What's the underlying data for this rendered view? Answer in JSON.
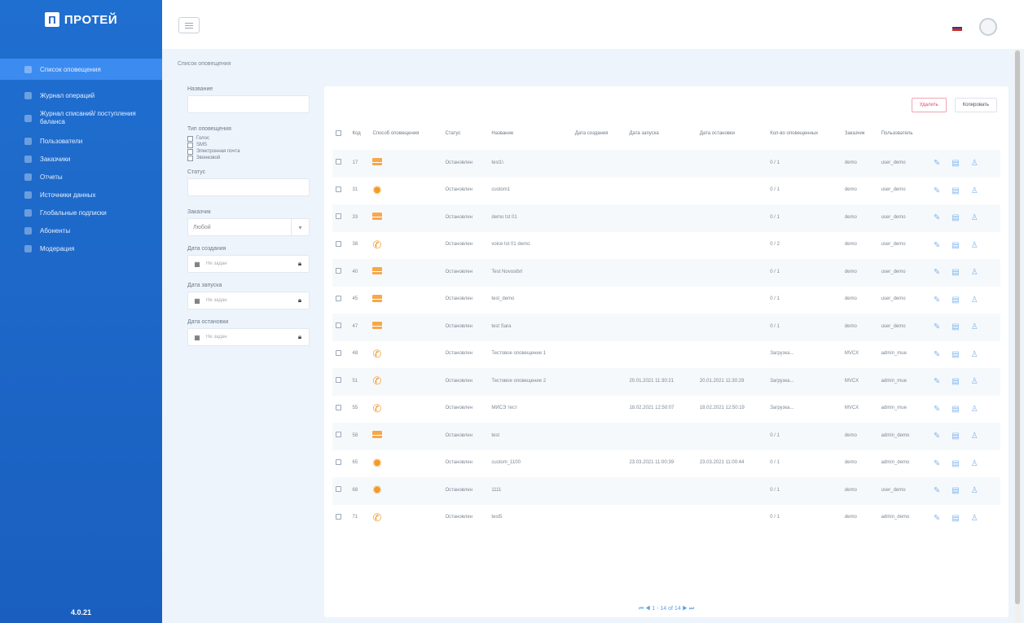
{
  "app": {
    "logo_mark": "Π",
    "logo_text": "ПРОТЕЙ",
    "version": "4.0.21"
  },
  "sidebar": {
    "items": [
      {
        "label": "Список оповещения",
        "active": true
      },
      {
        "label": "Журнал операций"
      },
      {
        "label": "Журнал списаний/ поступления баланса"
      },
      {
        "label": "Пользователи"
      },
      {
        "label": "Заказчики"
      },
      {
        "label": "Отчеты"
      },
      {
        "label": "Источники данных"
      },
      {
        "label": "Глобальные подписки"
      },
      {
        "label": "Абоненты"
      },
      {
        "label": "Модерация"
      }
    ]
  },
  "topbar": {
    "flag_colors": [
      "#ffffff",
      "#1c3fb0",
      "#d52b1e"
    ]
  },
  "breadcrumb": "Список оповещения",
  "filters": {
    "name_label": "Название",
    "type_label": "Тип оповещения",
    "type_options": [
      "Голос",
      "SMS",
      "Электронная почта",
      "Звонковой"
    ],
    "status_label": "Статус",
    "customer_label": "Заказчик",
    "customer_value": "Любой",
    "created_label": "Дата создания",
    "launch_label": "Дата запуска",
    "stop_label": "Дата остановки",
    "date_placeholder": "Не задан"
  },
  "panel": {
    "delete_label": "Удалить",
    "copy_label": "Копировать",
    "columns": [
      "Код",
      "Способ оповещения",
      "Статус",
      "Название",
      "Дата создания",
      "Дата запуска",
      "Дата остановки",
      "Кол-во оповещенных",
      "Заказчик",
      "Пользователь"
    ],
    "rows": [
      {
        "code": "17",
        "type": "email",
        "status": "Остановлен",
        "name": "test1\\",
        "created": "",
        "launched": "",
        "stopped": "",
        "count": "0 / 1",
        "customer": "demo",
        "user": "user_demo"
      },
      {
        "code": "31",
        "type": "gear",
        "status": "Остановлен",
        "name": "custom1",
        "created": "",
        "launched": "",
        "stopped": "",
        "count": "0 / 1",
        "customer": "demo",
        "user": "user_demo"
      },
      {
        "code": "33",
        "type": "email",
        "status": "Остановлен",
        "name": "demo tst 01",
        "created": "",
        "launched": "",
        "stopped": "",
        "count": "0 / 1",
        "customer": "demo",
        "user": "user_demo"
      },
      {
        "code": "38",
        "type": "phone",
        "status": "Остановлен",
        "name": "voice tst 01 demo",
        "created": "",
        "launched": "",
        "stopped": "",
        "count": "0 / 2",
        "customer": "demo",
        "user": "user_demo"
      },
      {
        "code": "40",
        "type": "email",
        "status": "Остановлен",
        "name": "Test Novosibrl",
        "created": "",
        "launched": "",
        "stopped": "",
        "count": "0 / 1",
        "customer": "demo",
        "user": "user_demo"
      },
      {
        "code": "45",
        "type": "email",
        "status": "Остановлен",
        "name": "test_demo",
        "created": "",
        "launched": "",
        "stopped": "",
        "count": "0 / 1",
        "customer": "demo",
        "user": "user_demo"
      },
      {
        "code": "47",
        "type": "email",
        "status": "Остановлен",
        "name": "test Sara",
        "created": "",
        "launched": "",
        "stopped": "",
        "count": "0 / 1",
        "customer": "demo",
        "user": "user_demo"
      },
      {
        "code": "48",
        "type": "phone",
        "status": "Остановлен",
        "name": "Тестовое оповещение 1",
        "created": "",
        "launched": "",
        "stopped": "",
        "count": "Загрузка...",
        "customer": "MVCX",
        "user": "admin_mue"
      },
      {
        "code": "51",
        "type": "phone",
        "status": "Остановлен",
        "name": "Тестовое оповещение 2",
        "created": "",
        "launched": "20.01.2021 11:30:21",
        "stopped": "20.01.2021 11:30:29",
        "count": "Загрузка...",
        "customer": "MVCX",
        "user": "admin_mue"
      },
      {
        "code": "55",
        "type": "phone",
        "status": "Остановлен",
        "name": "МИСЭ тест",
        "created": "",
        "launched": "18.02.2021 12:50:07",
        "stopped": "18.02.2021 12:50:19",
        "count": "Загрузка...",
        "customer": "MVCX",
        "user": "admin_mue"
      },
      {
        "code": "58",
        "type": "email",
        "status": "Остановлен",
        "name": "test",
        "created": "",
        "launched": "",
        "stopped": "",
        "count": "0 / 1",
        "customer": "demo",
        "user": "admin_demo"
      },
      {
        "code": "65",
        "type": "gear",
        "status": "Остановлен",
        "name": "custom_1100",
        "created": "",
        "launched": "23.03.2021 11:00:39",
        "stopped": "23.03.2021 11:00:44",
        "count": "0 / 1",
        "customer": "demo",
        "user": "admin_demo"
      },
      {
        "code": "68",
        "type": "gear",
        "status": "Остановлен",
        "name": "1111",
        "created": "",
        "launched": "",
        "stopped": "",
        "count": "0 / 1",
        "customer": "demo",
        "user": "user_demo"
      },
      {
        "code": "71",
        "type": "phone",
        "status": "Остановлен",
        "name": "test5",
        "created": "",
        "launched": "",
        "stopped": "",
        "count": "0 / 1",
        "customer": "demo",
        "user": "admin_demo"
      }
    ],
    "pager_text": "⏮ ◀ 1 - 14 of 14 ▶ ⏭"
  }
}
